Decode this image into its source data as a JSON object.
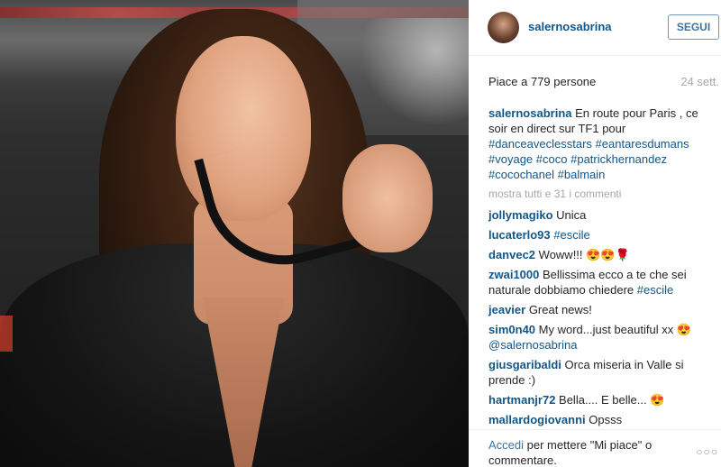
{
  "post": {
    "username": "salernosabrina",
    "follow_label": "SEGUI",
    "likes": "Piace a 779 persone",
    "time": "24 sett."
  },
  "caption": {
    "user": "salernosabrina",
    "text": " En route pour Paris , ce soir en direct sur TF1 pour ",
    "tags": [
      "#danceaveclesstars",
      "#eantaresdumans",
      "#voyage",
      "#coco",
      "#patrickhernandez",
      "#cocochanel",
      "#balmain"
    ]
  },
  "more_comments": "mostra tutti e 31 i commenti",
  "comments": [
    {
      "user": "jollymagiko",
      "text": " Unica",
      "tag": ""
    },
    {
      "user": "lucaterlo93",
      "text": " ",
      "tag": "#escile"
    },
    {
      "user": "danvec2",
      "text": " Woww!!! 😍😍🌹",
      "tag": ""
    },
    {
      "user": "zwai1000",
      "text": " Bellissima ecco a te che sei naturale dobbiamo chiedere ",
      "tag": "#escile"
    },
    {
      "user": "jeavier",
      "text": " Great news!",
      "tag": ""
    },
    {
      "user": "sim0n40",
      "text": " My word...just beautiful xx 😍 ",
      "tag": "@salernosabrina"
    },
    {
      "user": "giusgaribaldi",
      "text": " Orca miseria in Valle si prende :)",
      "tag": ""
    },
    {
      "user": "hartmanjr72",
      "text": " Bella.... E belle... 😍",
      "tag": ""
    },
    {
      "user": "mallardogiovanni",
      "text": " Opsss",
      "tag": ""
    }
  ],
  "footer": {
    "link": "Accedi",
    "text": " per mettere \"Mi piace\" o commentare.",
    "more": "○○○"
  }
}
